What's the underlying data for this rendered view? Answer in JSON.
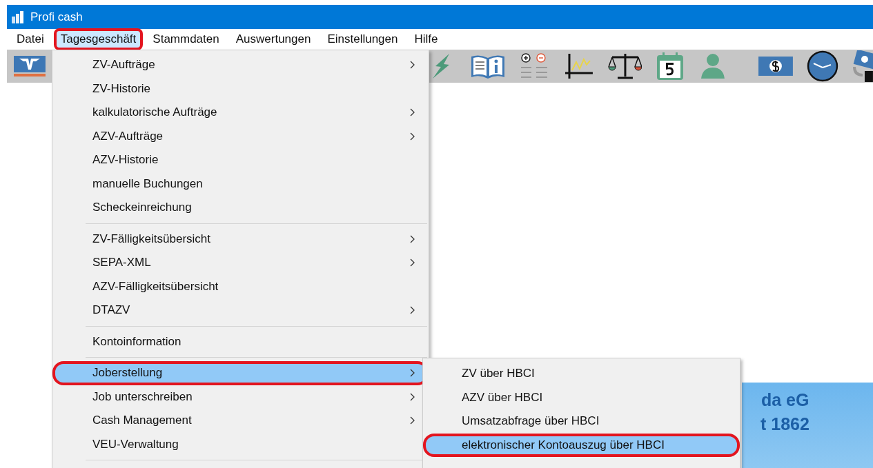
{
  "window": {
    "title": "Profi cash"
  },
  "menu_bar": [
    {
      "label": "Datei",
      "selected": false,
      "annotated": false
    },
    {
      "label": "Tagesgeschäft",
      "selected": true,
      "annotated": true
    },
    {
      "label": "Stammdaten",
      "selected": false,
      "annotated": false
    },
    {
      "label": "Auswertungen",
      "selected": false,
      "annotated": false
    },
    {
      "label": "Einstellungen",
      "selected": false,
      "annotated": false
    },
    {
      "label": "Hilfe",
      "selected": false,
      "annotated": false
    }
  ],
  "dropdown": {
    "items": [
      {
        "kind": "item",
        "label": "ZV-Aufträge",
        "submenu": true,
        "selected": false,
        "annotated": false
      },
      {
        "kind": "item",
        "label": "ZV-Historie",
        "submenu": false,
        "selected": false,
        "annotated": false
      },
      {
        "kind": "item",
        "label": "kalkulatorische Aufträge",
        "submenu": true,
        "selected": false,
        "annotated": false
      },
      {
        "kind": "item",
        "label": "AZV-Aufträge",
        "submenu": true,
        "selected": false,
        "annotated": false
      },
      {
        "kind": "item",
        "label": "AZV-Historie",
        "submenu": false,
        "selected": false,
        "annotated": false
      },
      {
        "kind": "item",
        "label": "manuelle Buchungen",
        "submenu": false,
        "selected": false,
        "annotated": false
      },
      {
        "kind": "item",
        "label": "Scheckeinreichung",
        "submenu": false,
        "selected": false,
        "annotated": false
      },
      {
        "kind": "separator"
      },
      {
        "kind": "item",
        "label": "ZV-Fälligkeitsübersicht",
        "submenu": true,
        "selected": false,
        "annotated": false
      },
      {
        "kind": "item",
        "label": "SEPA-XML",
        "submenu": true,
        "selected": false,
        "annotated": false
      },
      {
        "kind": "item",
        "label": "AZV-Fälligkeitsübersicht",
        "submenu": false,
        "selected": false,
        "annotated": false
      },
      {
        "kind": "item",
        "label": "DTAZV",
        "submenu": true,
        "selected": false,
        "annotated": false
      },
      {
        "kind": "separator"
      },
      {
        "kind": "item",
        "label": "Kontoinformation",
        "submenu": false,
        "selected": false,
        "annotated": false
      },
      {
        "kind": "separator"
      },
      {
        "kind": "item",
        "label": "Joberstellung",
        "submenu": true,
        "selected": true,
        "annotated": true
      },
      {
        "kind": "item",
        "label": "Job unterschreiben",
        "submenu": true,
        "selected": false,
        "annotated": false
      },
      {
        "kind": "item",
        "label": "Cash Management",
        "submenu": true,
        "selected": false,
        "annotated": false
      },
      {
        "kind": "item",
        "label": "VEU-Verwaltung",
        "submenu": false,
        "selected": false,
        "annotated": false
      },
      {
        "kind": "separator"
      }
    ]
  },
  "submenu": {
    "items": [
      {
        "label": "ZV über HBCI",
        "selected": false,
        "annotated": false
      },
      {
        "label": "AZV über HBCI",
        "selected": false,
        "annotated": false
      },
      {
        "label": "Umsatzabfrage über HBCI",
        "selected": false,
        "annotated": false
      },
      {
        "label": "elektronischer Kontoauszug über HBCI",
        "selected": true,
        "annotated": true
      }
    ]
  },
  "banner": {
    "lines": [
      "da eG",
      "t 1862"
    ]
  }
}
